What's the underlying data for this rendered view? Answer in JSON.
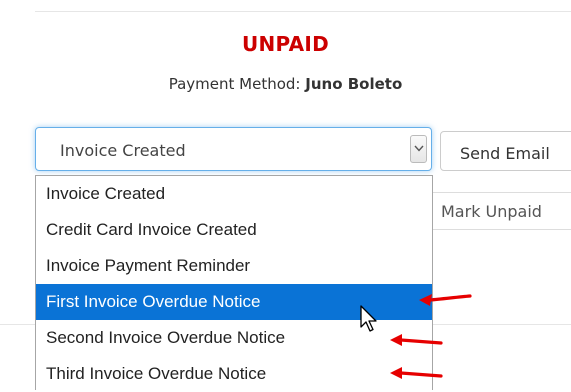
{
  "invoice": {
    "status": "UNPAID",
    "payment_method_label": "Payment Method:",
    "payment_method_value": "Juno Boleto"
  },
  "email_select": {
    "selected": "Invoice Created",
    "options": [
      "Invoice Created",
      "Credit Card Invoice Created",
      "Invoice Payment Reminder",
      "First Invoice Overdue Notice",
      "Second Invoice Overdue Notice",
      "Third Invoice Overdue Notice"
    ],
    "highlighted_option": "First Invoice Overdue Notice"
  },
  "buttons": {
    "send_email": "Send Email",
    "mark_unpaid": "Mark Unpaid"
  },
  "colors": {
    "status": "#cc0000",
    "highlight": "#0a73d6",
    "annotation_arrow": "#e60000"
  },
  "icons": {
    "select_arrow": "chevron-down-icon",
    "mouse_cursor": "mouse-pointer-icon",
    "annotation": "red-arrow-icon"
  }
}
